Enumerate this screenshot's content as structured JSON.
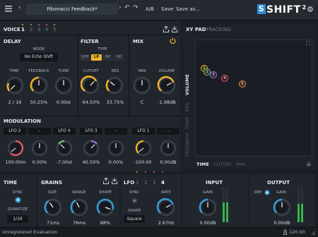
{
  "topbar": {
    "preset_name": "Fibonacci Feedback*",
    "ab_label": "A/B",
    "save_label": "Save",
    "save_as_label": "Save as...",
    "logo_text": "SHIFT",
    "logo_version": "2"
  },
  "voice": {
    "title": "VOICE",
    "tabs": [
      "1",
      "2",
      "3",
      "4",
      "5"
    ]
  },
  "delay": {
    "title": "DELAY",
    "mode_label": "MODE",
    "mode_value": "No Echo Shift",
    "time_label": "TIME",
    "time_value": "2 / 16",
    "feedback_label": "FEEDBACK",
    "feedback_value": "50.25%",
    "tune_label": "TUNE",
    "tune_value": "0.00st"
  },
  "filter": {
    "title": "FILTER",
    "type_label": "TYPE",
    "types": [
      "OFF",
      "LP",
      "BP",
      "HP"
    ],
    "active_type": "LP",
    "cutoff_label": "CUTOFF",
    "cutoff_value": "64.50%",
    "res_label": "RES",
    "res_value": "33.75%"
  },
  "mix": {
    "title": "MIX",
    "pan_label": "PAN",
    "pan_value": "C",
    "volume_label": "VOLUME",
    "volume_value": "-1.98dB"
  },
  "modulation": {
    "title": "MODULATION",
    "slots": [
      {
        "source": "LFO 2",
        "target": "-",
        "value": "100.00m"
      },
      {
        "source": "-",
        "target": "-",
        "value": "0.00%"
      },
      {
        "source": "LFO 4",
        "target": "",
        "value": "-7.00st"
      },
      {
        "source": "LFO 3",
        "target": "-",
        "value": "40.50%"
      },
      {
        "source": "-",
        "target": "",
        "value": "0.00%"
      },
      {
        "source": "LFO 1",
        "target": "-",
        "value": "-100.00"
      },
      {
        "source": "-",
        "target": "",
        "value": "0.00dB"
      }
    ]
  },
  "xypad": {
    "tab_active": "XY PAD",
    "tab_inactive": "TRACKING",
    "points": [
      "1",
      "2",
      "3",
      "4",
      "5"
    ],
    "left_tabs": [
      "VOLUME",
      "RES",
      "TUNE",
      "FEEDBACK"
    ],
    "bottom_tabs": [
      "TIME",
      "CUTOFF",
      "PAN"
    ]
  },
  "time": {
    "title": "TIME",
    "sync_label": "SYNC",
    "quantize_label": "QUANTIZE",
    "quantize_value": "1/16"
  },
  "grains": {
    "title": "GRAINS",
    "size_label": "SIZE",
    "size_value": "71ms",
    "range_label": "RANGE",
    "range_value": "76ms",
    "shape_label": "SHAPE",
    "shape_value": "88%"
  },
  "lfo": {
    "title": "LFO",
    "tabs": [
      "1",
      "2",
      "3",
      "4"
    ],
    "sync_label": "SYNC",
    "rate_label": "RATE",
    "rate_value": "2.67Hz",
    "shape_label": "SHAPE",
    "shape_value": "Square"
  },
  "input": {
    "title": "INPUT",
    "gain_label": "GAIN",
    "gain_value": "0.00dB"
  },
  "output": {
    "title": "OUTPUT",
    "dry_label": "DRY",
    "gain_label": "GAIN",
    "gain_value": "0.00dB"
  },
  "status": {
    "left_text": "Unregistered Evaluation",
    "tempo": "120.00"
  },
  "colors": {
    "accent_yellow": "#f0b429",
    "accent_blue": "#3b9bd6",
    "voice_colors": [
      "#f0b429",
      "#7cc36a",
      "#a070e0",
      "#e8566a",
      "#f08a3c"
    ]
  }
}
